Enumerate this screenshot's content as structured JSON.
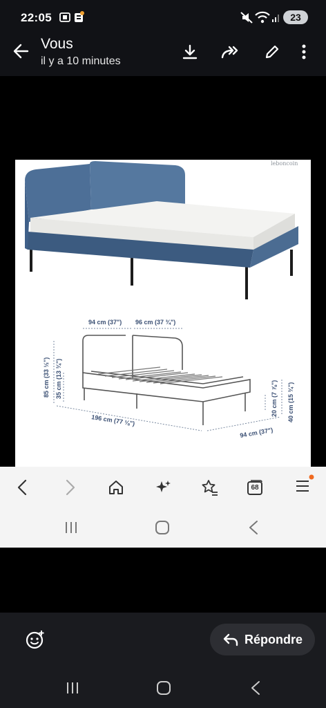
{
  "status_bar": {
    "time": "22:05",
    "battery": "23",
    "icons": [
      "screen-record-icon",
      "app-notification-icon",
      "mute-icon",
      "wifi-icon",
      "signal-icon"
    ]
  },
  "header": {
    "title": "Vous",
    "subtitle": "il y a 10 minutes",
    "actions": [
      "download-icon",
      "forward-icon",
      "edit-icon",
      "more-icon"
    ]
  },
  "image": {
    "watermark": "leboncoin",
    "dimensions": {
      "top_width": "94 cm (37\")",
      "top_width2": "96 cm (37 ¾\")",
      "height_total": "85 cm (33 ½\")",
      "height_seat": "35 cm (13 ¾\")",
      "length": "196 cm (77 ⅛\")",
      "depth": "94 cm (37\")",
      "leg_height": "20 cm (7 ⅞\")",
      "side_height": "40 cm (15 ¾\")"
    },
    "colors": {
      "fabric": "#4d6f97",
      "fabric_dark": "#3c5b80",
      "mattress": "#f3f3f1",
      "legs": "#1c1c1c"
    }
  },
  "browser_bar": {
    "icons": [
      "back-icon",
      "forward-nav-icon",
      "home-icon",
      "sparkle-icon",
      "bookmark-star-icon",
      "tabs-icon",
      "menu-icon"
    ],
    "tabs_count": "68"
  },
  "reply": {
    "label": "Répondre"
  }
}
